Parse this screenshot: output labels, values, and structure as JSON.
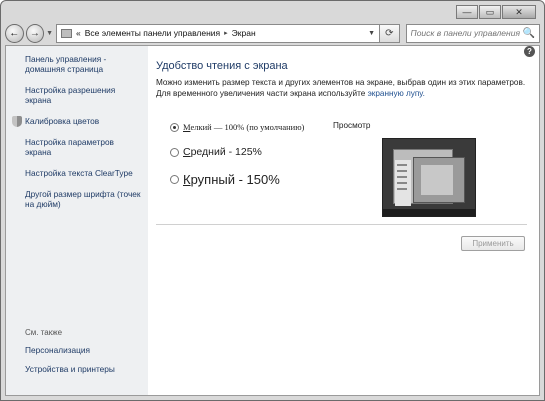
{
  "window": {
    "controls": {
      "minimize": "—",
      "maximize": "▭",
      "close": "✕"
    }
  },
  "nav": {
    "back_icon": "←",
    "forward_icon": "→",
    "breadcrumb": {
      "prefix": "«",
      "segment1": "Все элементы панели управления",
      "separator": "▸",
      "segment2": "Экран"
    },
    "refresh_icon": "⟳",
    "search_placeholder": "Поиск в панели управления",
    "search_icon": "🔍"
  },
  "sidebar": {
    "links": [
      "Панель управления - домашняя страница",
      "Настройка разрешения экрана",
      "Калибровка цветов",
      "Настройка параметров экрана",
      "Настройка текста ClearType",
      "Другой размер шрифта (точек на дюйм)"
    ],
    "see_also_label": "См. также",
    "see_also_links": [
      "Персонализация",
      "Устройства и принтеры"
    ]
  },
  "main": {
    "help_icon": "?",
    "title": "Удобство чтения с экрана",
    "description": "Можно изменить размер текста и других элементов на экране, выбрав один из этих параметров. Для временного увеличения части экрана используйте",
    "magnifier_link": "экранную лупу.",
    "options": {
      "small_underlined": "М",
      "small_rest": "елкий — 100% (по умолчанию)",
      "medium_underlined": "С",
      "medium_rest": "редний - 125%",
      "large_underlined": "К",
      "large_rest": "рупный - 150%"
    },
    "selected_option": "small",
    "preview_label": "Просмотр",
    "apply_button": "Применить"
  }
}
